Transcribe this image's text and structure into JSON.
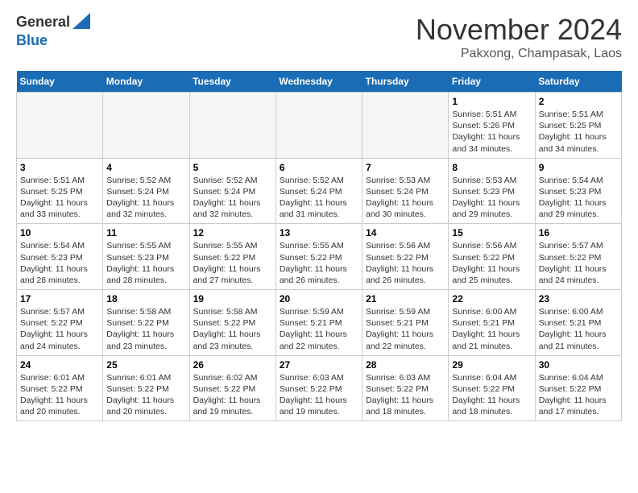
{
  "logo": {
    "line1": "General",
    "line2": "Blue"
  },
  "title": "November 2024",
  "subtitle": "Pakxong, Champasak, Laos",
  "days_of_week": [
    "Sunday",
    "Monday",
    "Tuesday",
    "Wednesday",
    "Thursday",
    "Friday",
    "Saturday"
  ],
  "weeks": [
    [
      {
        "day": "",
        "sunrise": "",
        "sunset": "",
        "daylight": ""
      },
      {
        "day": "",
        "sunrise": "",
        "sunset": "",
        "daylight": ""
      },
      {
        "day": "",
        "sunrise": "",
        "sunset": "",
        "daylight": ""
      },
      {
        "day": "",
        "sunrise": "",
        "sunset": "",
        "daylight": ""
      },
      {
        "day": "",
        "sunrise": "",
        "sunset": "",
        "daylight": ""
      },
      {
        "day": "1",
        "sunrise": "Sunrise: 5:51 AM",
        "sunset": "Sunset: 5:26 PM",
        "daylight": "Daylight: 11 hours and 34 minutes."
      },
      {
        "day": "2",
        "sunrise": "Sunrise: 5:51 AM",
        "sunset": "Sunset: 5:25 PM",
        "daylight": "Daylight: 11 hours and 34 minutes."
      }
    ],
    [
      {
        "day": "3",
        "sunrise": "Sunrise: 5:51 AM",
        "sunset": "Sunset: 5:25 PM",
        "daylight": "Daylight: 11 hours and 33 minutes."
      },
      {
        "day": "4",
        "sunrise": "Sunrise: 5:52 AM",
        "sunset": "Sunset: 5:24 PM",
        "daylight": "Daylight: 11 hours and 32 minutes."
      },
      {
        "day": "5",
        "sunrise": "Sunrise: 5:52 AM",
        "sunset": "Sunset: 5:24 PM",
        "daylight": "Daylight: 11 hours and 32 minutes."
      },
      {
        "day": "6",
        "sunrise": "Sunrise: 5:52 AM",
        "sunset": "Sunset: 5:24 PM",
        "daylight": "Daylight: 11 hours and 31 minutes."
      },
      {
        "day": "7",
        "sunrise": "Sunrise: 5:53 AM",
        "sunset": "Sunset: 5:24 PM",
        "daylight": "Daylight: 11 hours and 30 minutes."
      },
      {
        "day": "8",
        "sunrise": "Sunrise: 5:53 AM",
        "sunset": "Sunset: 5:23 PM",
        "daylight": "Daylight: 11 hours and 29 minutes."
      },
      {
        "day": "9",
        "sunrise": "Sunrise: 5:54 AM",
        "sunset": "Sunset: 5:23 PM",
        "daylight": "Daylight: 11 hours and 29 minutes."
      }
    ],
    [
      {
        "day": "10",
        "sunrise": "Sunrise: 5:54 AM",
        "sunset": "Sunset: 5:23 PM",
        "daylight": "Daylight: 11 hours and 28 minutes."
      },
      {
        "day": "11",
        "sunrise": "Sunrise: 5:55 AM",
        "sunset": "Sunset: 5:23 PM",
        "daylight": "Daylight: 11 hours and 28 minutes."
      },
      {
        "day": "12",
        "sunrise": "Sunrise: 5:55 AM",
        "sunset": "Sunset: 5:22 PM",
        "daylight": "Daylight: 11 hours and 27 minutes."
      },
      {
        "day": "13",
        "sunrise": "Sunrise: 5:55 AM",
        "sunset": "Sunset: 5:22 PM",
        "daylight": "Daylight: 11 hours and 26 minutes."
      },
      {
        "day": "14",
        "sunrise": "Sunrise: 5:56 AM",
        "sunset": "Sunset: 5:22 PM",
        "daylight": "Daylight: 11 hours and 26 minutes."
      },
      {
        "day": "15",
        "sunrise": "Sunrise: 5:56 AM",
        "sunset": "Sunset: 5:22 PM",
        "daylight": "Daylight: 11 hours and 25 minutes."
      },
      {
        "day": "16",
        "sunrise": "Sunrise: 5:57 AM",
        "sunset": "Sunset: 5:22 PM",
        "daylight": "Daylight: 11 hours and 24 minutes."
      }
    ],
    [
      {
        "day": "17",
        "sunrise": "Sunrise: 5:57 AM",
        "sunset": "Sunset: 5:22 PM",
        "daylight": "Daylight: 11 hours and 24 minutes."
      },
      {
        "day": "18",
        "sunrise": "Sunrise: 5:58 AM",
        "sunset": "Sunset: 5:22 PM",
        "daylight": "Daylight: 11 hours and 23 minutes."
      },
      {
        "day": "19",
        "sunrise": "Sunrise: 5:58 AM",
        "sunset": "Sunset: 5:22 PM",
        "daylight": "Daylight: 11 hours and 23 minutes."
      },
      {
        "day": "20",
        "sunrise": "Sunrise: 5:59 AM",
        "sunset": "Sunset: 5:21 PM",
        "daylight": "Daylight: 11 hours and 22 minutes."
      },
      {
        "day": "21",
        "sunrise": "Sunrise: 5:59 AM",
        "sunset": "Sunset: 5:21 PM",
        "daylight": "Daylight: 11 hours and 22 minutes."
      },
      {
        "day": "22",
        "sunrise": "Sunrise: 6:00 AM",
        "sunset": "Sunset: 5:21 PM",
        "daylight": "Daylight: 11 hours and 21 minutes."
      },
      {
        "day": "23",
        "sunrise": "Sunrise: 6:00 AM",
        "sunset": "Sunset: 5:21 PM",
        "daylight": "Daylight: 11 hours and 21 minutes."
      }
    ],
    [
      {
        "day": "24",
        "sunrise": "Sunrise: 6:01 AM",
        "sunset": "Sunset: 5:22 PM",
        "daylight": "Daylight: 11 hours and 20 minutes."
      },
      {
        "day": "25",
        "sunrise": "Sunrise: 6:01 AM",
        "sunset": "Sunset: 5:22 PM",
        "daylight": "Daylight: 11 hours and 20 minutes."
      },
      {
        "day": "26",
        "sunrise": "Sunrise: 6:02 AM",
        "sunset": "Sunset: 5:22 PM",
        "daylight": "Daylight: 11 hours and 19 minutes."
      },
      {
        "day": "27",
        "sunrise": "Sunrise: 6:03 AM",
        "sunset": "Sunset: 5:22 PM",
        "daylight": "Daylight: 11 hours and 19 minutes."
      },
      {
        "day": "28",
        "sunrise": "Sunrise: 6:03 AM",
        "sunset": "Sunset: 5:22 PM",
        "daylight": "Daylight: 11 hours and 18 minutes."
      },
      {
        "day": "29",
        "sunrise": "Sunrise: 6:04 AM",
        "sunset": "Sunset: 5:22 PM",
        "daylight": "Daylight: 11 hours and 18 minutes."
      },
      {
        "day": "30",
        "sunrise": "Sunrise: 6:04 AM",
        "sunset": "Sunset: 5:22 PM",
        "daylight": "Daylight: 11 hours and 17 minutes."
      }
    ]
  ]
}
